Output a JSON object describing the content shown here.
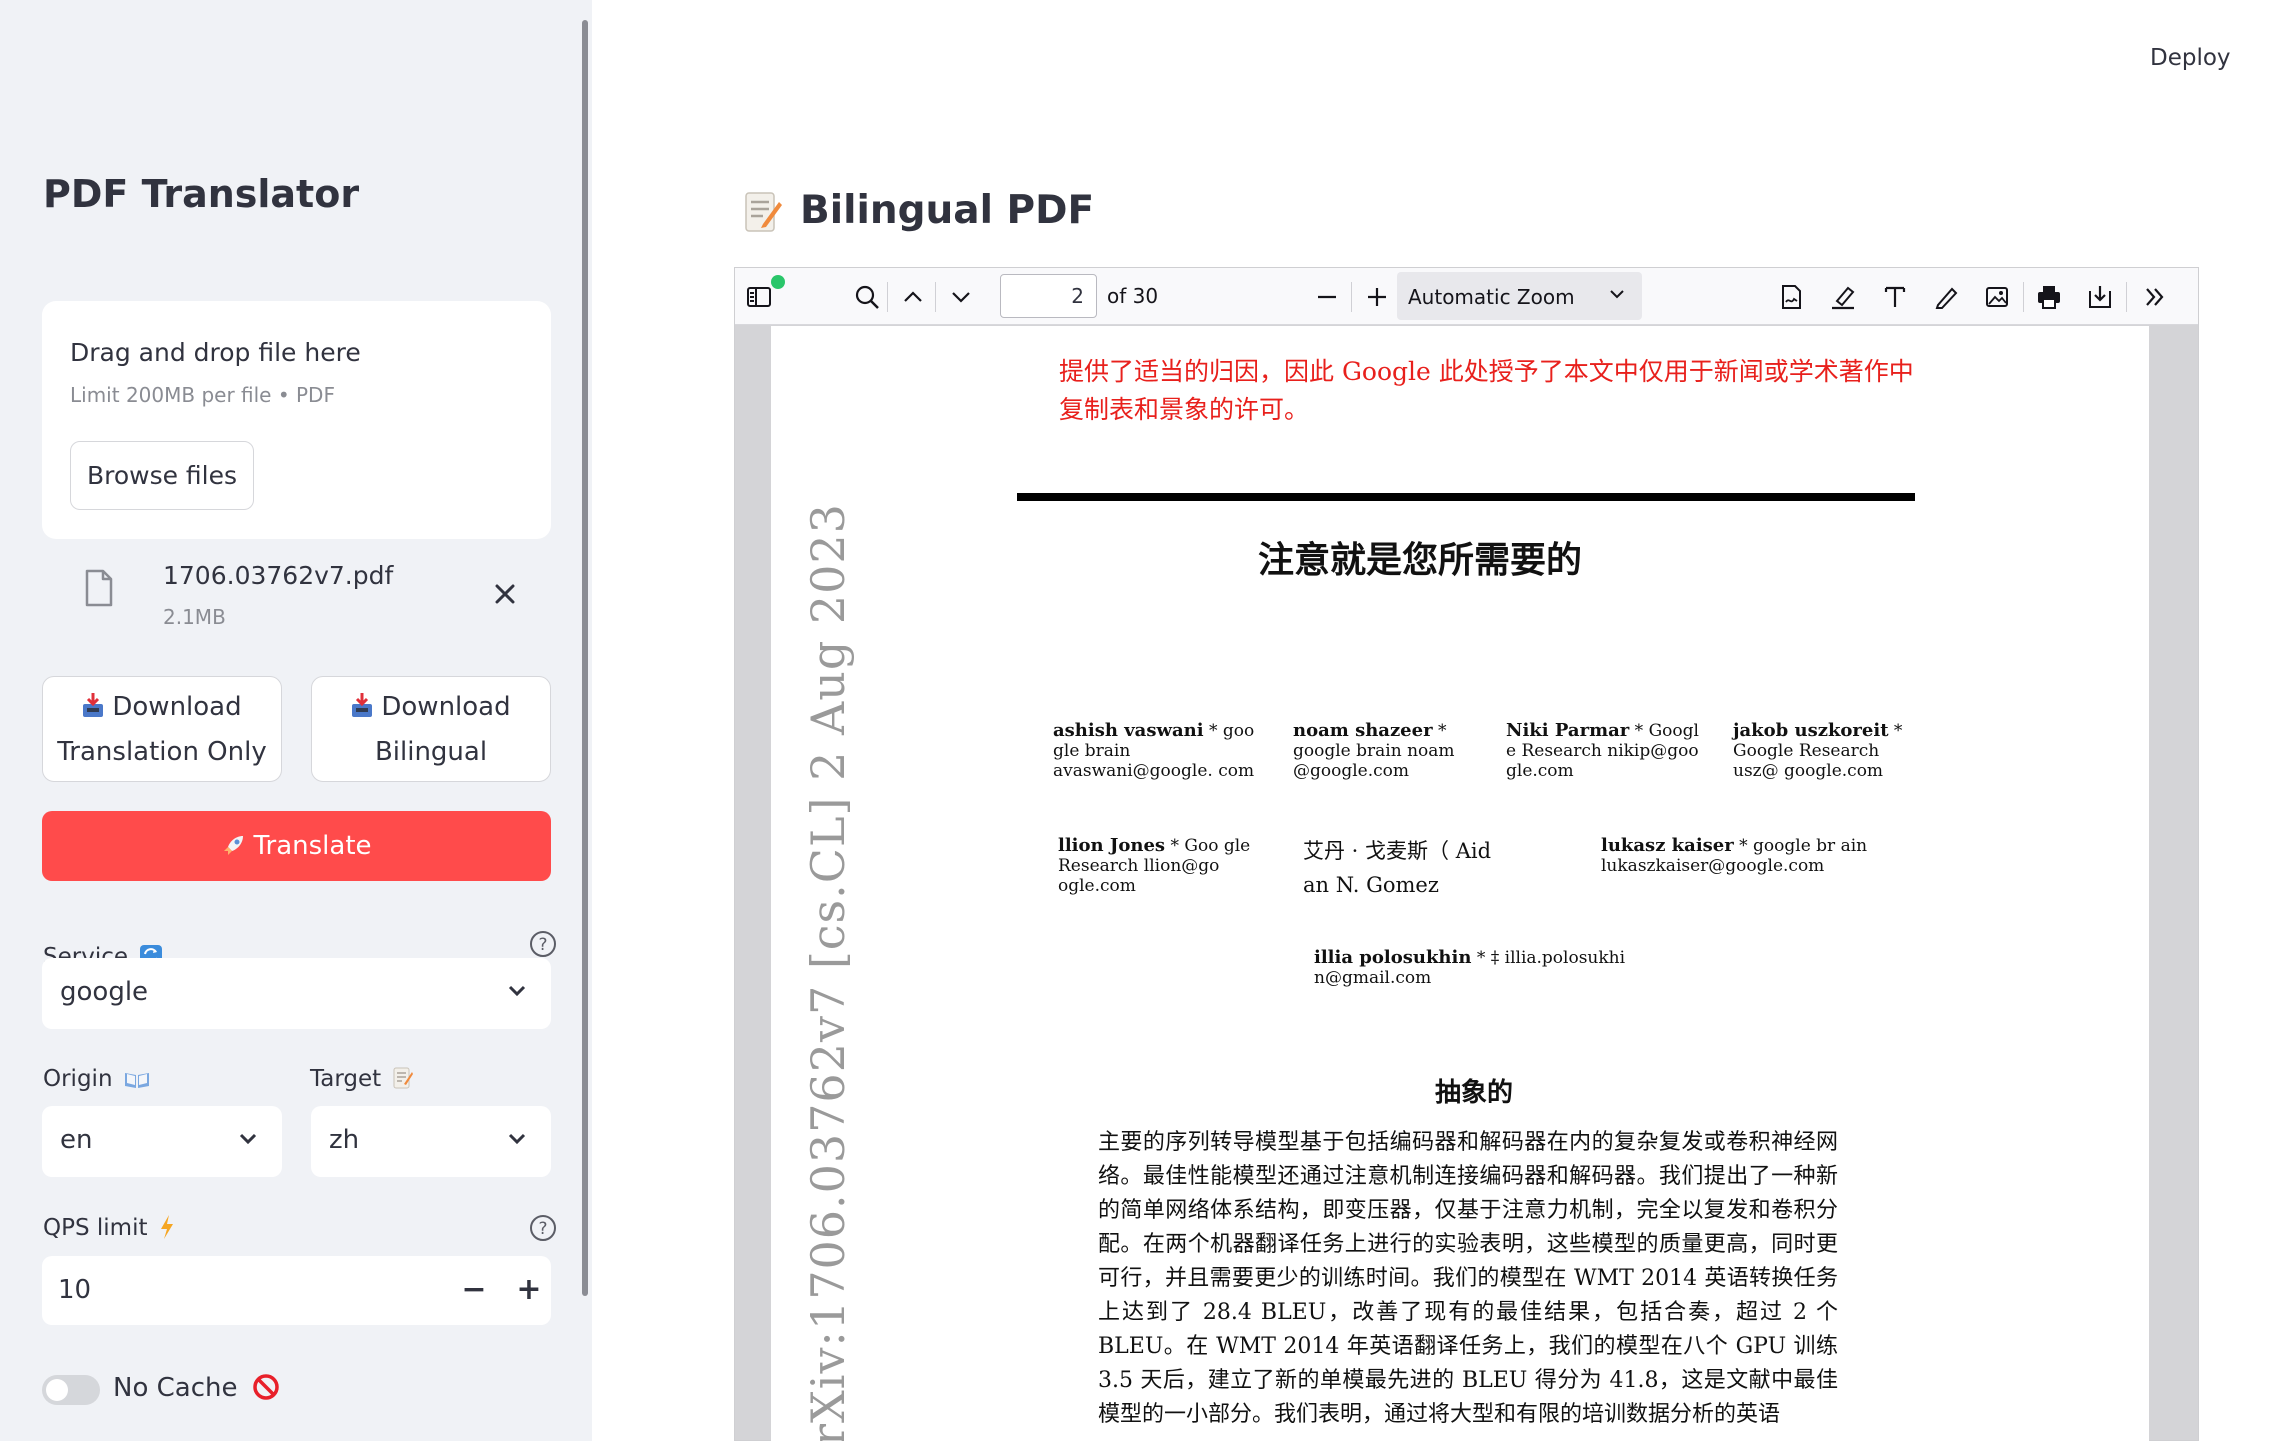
{
  "sidebar": {
    "title": "PDF Translator",
    "uploader": {
      "drag_text": "Drag and drop file here",
      "limit_text": "Limit 200MB per file • PDF",
      "browse_label": "Browse files"
    },
    "file": {
      "name": "1706.03762v7.pdf",
      "size": "2.1MB"
    },
    "download_translation": {
      "line1": "Download",
      "line2": "Translation Only"
    },
    "download_bilingual": {
      "line1": "Download",
      "line2": "Bilingual"
    },
    "translate_label": "Translate",
    "service": {
      "label": "Service",
      "value": "google"
    },
    "origin": {
      "label": "Origin",
      "value": "en"
    },
    "target": {
      "label": "Target",
      "value": "zh"
    },
    "qps": {
      "label": "QPS limit",
      "value": "10",
      "minus": "−",
      "plus": "+"
    },
    "no_cache": {
      "label": "No Cache",
      "enabled": false
    }
  },
  "header": {
    "deploy_label": "Deploy"
  },
  "main": {
    "title": "Bilingual PDF",
    "viewer": {
      "page_number": "2",
      "page_count_text": "of 30",
      "zoom": "Automatic Zoom"
    },
    "document": {
      "red_note": "提供了适当的归因，因此 Google 此处授予了本文中仅用于新闻或学术著作中复制表和景象的许可。",
      "title": "注意就是您所需要的",
      "arxiv_stamp": "rXiv:1706.03762v7  [cs.CL]  2 Aug 2023",
      "authors": [
        {
          "name": "ashish vaswani",
          "rest": " * goo gle brain avaswani@google. com"
        },
        {
          "name": "noam shazeer",
          "rest": " * google brain noam @google.com"
        },
        {
          "name": "Niki Parmar",
          "rest": " * Googl e Research nikip@goo gle.com"
        },
        {
          "name": "jakob uszkoreit",
          "rest": " * Google Research usz@ google.com"
        },
        {
          "name": "llion Jones",
          "rest": " * Goo gle Research llion@go ogle.com"
        },
        {
          "name": "艾丹 · 戈麦斯（ Aid",
          "rest": "an N. Gomez"
        },
        {
          "name": "lukasz kaiser",
          "rest": " * google br ain lukaszkaiser@google.com"
        },
        {
          "name": "illia polosukhin",
          "rest": " * ‡ illia.polosukhi n@gmail.com"
        }
      ],
      "abstract_title": "抽象的",
      "abstract": "主要的序列转导模型基于包括编码器和解码器在内的复杂复发或卷积神经网络。最佳性能模型还通过注意机制连接编码器和解码器。我们提出了一种新的简单网络体系结构，即变压器，仅基于注意力机制，完全以复发和卷积分配。在两个机器翻译任务上进行的实验表明，这些模型的质量更高，同时更可行，并且需要更少的训练时间。我们的模型在 WMT 2014 英语转换任务上达到了 28.4 BLEU，改善了现有的最佳结果，包括合奏，超过 2 个 BLEU。在 WMT 2014 年英语翻译任务上，我们的模型在八个 GPU 训练 3.5 天后，建立了新的单模最先进的 BLEU 得分为 41.8，这是文献中最佳模型的一小部分。我们表明，通过将大型和有限的培训数据分析的英语"
    }
  },
  "colors": {
    "primary": "#ff4b4b",
    "sidebar_bg": "#f0f2f6",
    "note_red": "#e8201c"
  }
}
